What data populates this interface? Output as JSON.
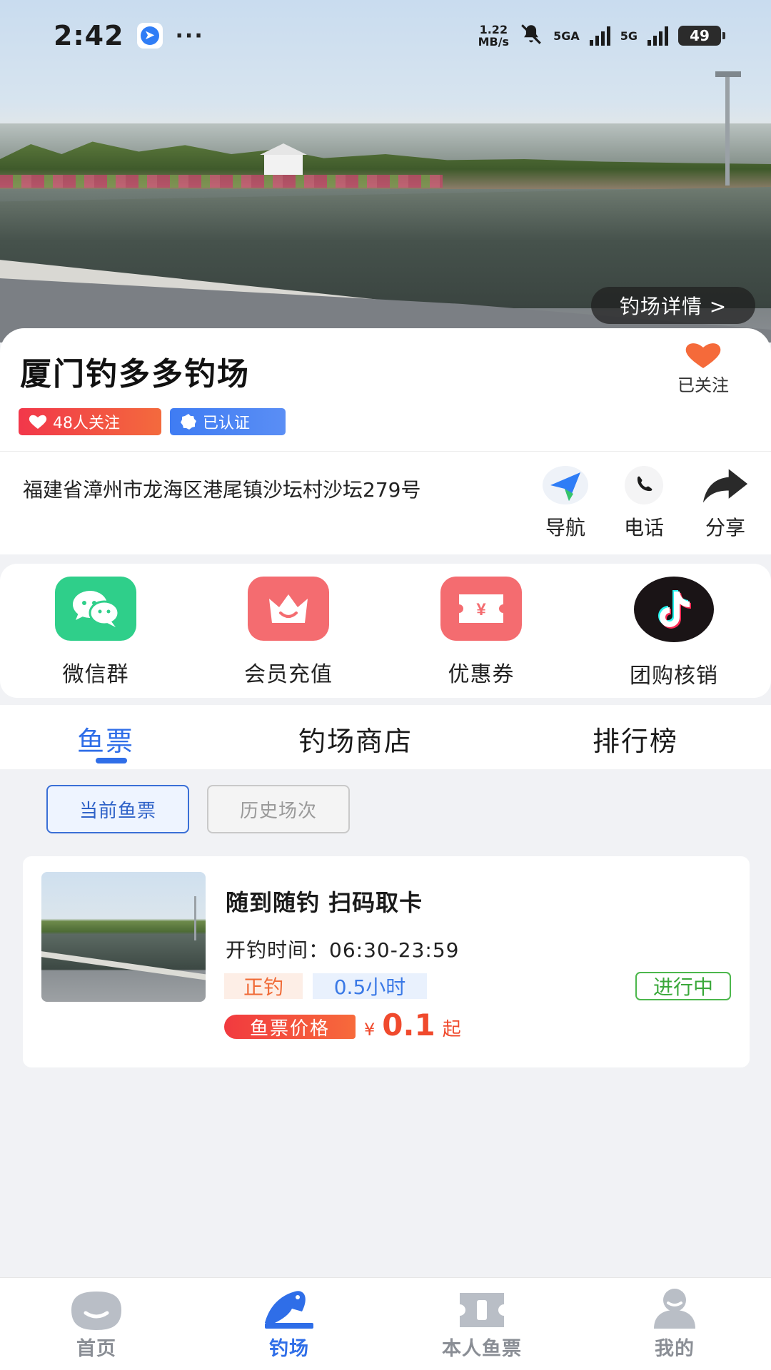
{
  "status_bar": {
    "time": "2:42",
    "speed_value": "1.22",
    "speed_unit": "MB/s",
    "net1": "5GA",
    "net2": "5G",
    "battery": "49"
  },
  "hero": {
    "detail_button": "钓场详情 >"
  },
  "venue": {
    "name": "厦门钓多多钓场",
    "follow_label": "已关注",
    "fans_badge": "48人关注",
    "cert_badge": "已认证",
    "address": "福建省漳州市龙海区港尾镇沙坛村沙坛279号"
  },
  "address_actions": [
    {
      "label": "导航",
      "icon": "navigation-icon"
    },
    {
      "label": "电话",
      "icon": "phone-icon"
    },
    {
      "label": "分享",
      "icon": "share-icon"
    }
  ],
  "quick_actions": [
    {
      "label": "微信群",
      "icon": "wechat-icon",
      "color": "#2fcf8a"
    },
    {
      "label": "会员充值",
      "icon": "crown-icon",
      "color": "#f46c70"
    },
    {
      "label": "优惠券",
      "icon": "coupon-icon",
      "color": "#f46c70"
    },
    {
      "label": "团购核销",
      "icon": "tiktok-icon",
      "color": "#1a1416"
    }
  ],
  "tabs": [
    {
      "label": "鱼票",
      "active": true
    },
    {
      "label": "钓场商店",
      "active": false
    },
    {
      "label": "排行榜",
      "active": false
    }
  ],
  "subtabs": [
    {
      "label": "当前鱼票",
      "active": true
    },
    {
      "label": "历史场次",
      "active": false
    }
  ],
  "ticket": {
    "title": "随到随钓 扫码取卡",
    "hours": "开钓时间：06:30-23:59",
    "mode_tag": "正钓",
    "duration_tag": "0.5小时",
    "status": "进行中",
    "price_label": "鱼票价格",
    "currency": "¥",
    "price": "0.1",
    "price_suffix": "起"
  },
  "bottom_nav": [
    {
      "label": "首页",
      "icon": "home-icon",
      "active": false
    },
    {
      "label": "钓场",
      "icon": "fishing-spot-icon",
      "active": true
    },
    {
      "label": "本人鱼票",
      "icon": "ticket-icon",
      "active": false
    },
    {
      "label": "我的",
      "icon": "profile-icon",
      "active": false
    }
  ],
  "colors": {
    "accent": "#2f6ee8",
    "price": "#f04a2d",
    "status_green": "#3aa83a",
    "follow_heart": "#f56a3a"
  }
}
